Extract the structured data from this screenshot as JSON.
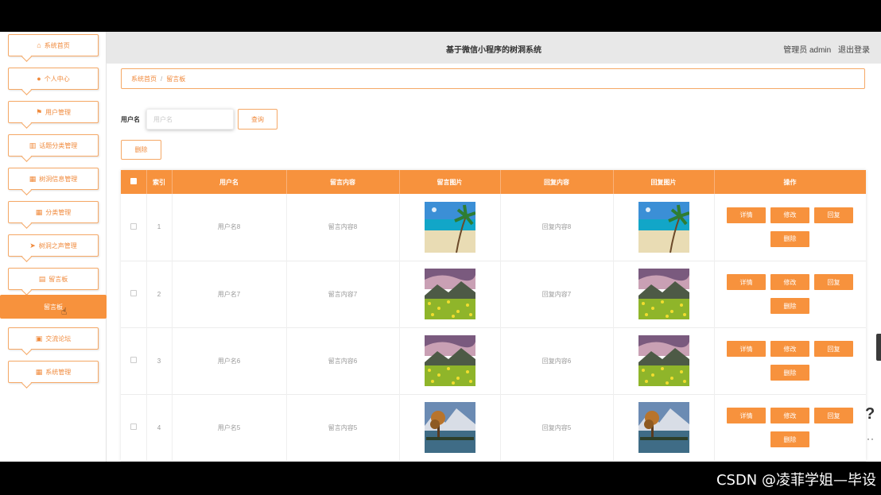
{
  "header": {
    "title": "基于微信小程序的树洞系统",
    "user": "管理员 admin",
    "logout": "退出登录"
  },
  "sidebar": {
    "items": [
      {
        "label": "系统首页",
        "icon": "home-icon",
        "glyph": "⌂"
      },
      {
        "label": "个人中心",
        "icon": "person-icon",
        "glyph": "●"
      },
      {
        "label": "用户管理",
        "icon": "flag-icon",
        "glyph": "⚑"
      },
      {
        "label": "话题分类管理",
        "icon": "bar-chart-icon",
        "glyph": "▥"
      },
      {
        "label": "树洞信息管理",
        "icon": "grid-icon",
        "glyph": "▦"
      },
      {
        "label": "分类管理",
        "icon": "grid-icon",
        "glyph": "▦"
      },
      {
        "label": "树洞之声管理",
        "icon": "paper-plane-icon",
        "glyph": "➤"
      },
      {
        "label": "留言板",
        "icon": "message-icon",
        "glyph": "▤"
      },
      {
        "label": "留言板",
        "icon": "",
        "glyph": "",
        "active": true
      },
      {
        "label": "交流论坛",
        "icon": "forum-icon",
        "glyph": "▣"
      },
      {
        "label": "系统管理",
        "icon": "grid-icon",
        "glyph": "▦"
      }
    ]
  },
  "breadcrumb": {
    "home": "系统首页",
    "separator": "/",
    "current": "留言板"
  },
  "search": {
    "label": "用户名",
    "placeholder": "用户名",
    "button": "查询"
  },
  "toolbar": {
    "delete_label": "删除"
  },
  "table": {
    "columns": [
      "",
      "索引",
      "用户名",
      "留言内容",
      "留言图片",
      "回复内容",
      "回复图片",
      "操作"
    ],
    "rows": [
      {
        "index": "1",
        "username": "用户名8",
        "message": "留言内容8",
        "image": "beach",
        "reply": "回复内容8",
        "reply_image": "beach"
      },
      {
        "index": "2",
        "username": "用户名7",
        "message": "留言内容7",
        "image": "flowers",
        "reply": "回复内容7",
        "reply_image": "flowers"
      },
      {
        "index": "3",
        "username": "用户名6",
        "message": "留言内容6",
        "image": "flowers",
        "reply": "回复内容6",
        "reply_image": "flowers"
      },
      {
        "index": "4",
        "username": "用户名5",
        "message": "留言内容5",
        "image": "lake",
        "reply": "回复内容5",
        "reply_image": "lake"
      }
    ],
    "actions": {
      "detail": "详情",
      "edit": "修改",
      "reply": "回复",
      "delete": "删除"
    }
  },
  "overlay": {
    "help_mark": "?",
    "dots": "··",
    "watermark": "CSDN @凌菲学姐—毕设"
  },
  "colors": {
    "accent": "#f7923d",
    "accent_border": "#f5a866",
    "accent_text": "#f08a3c",
    "header_bg": "#e8e8e8"
  }
}
